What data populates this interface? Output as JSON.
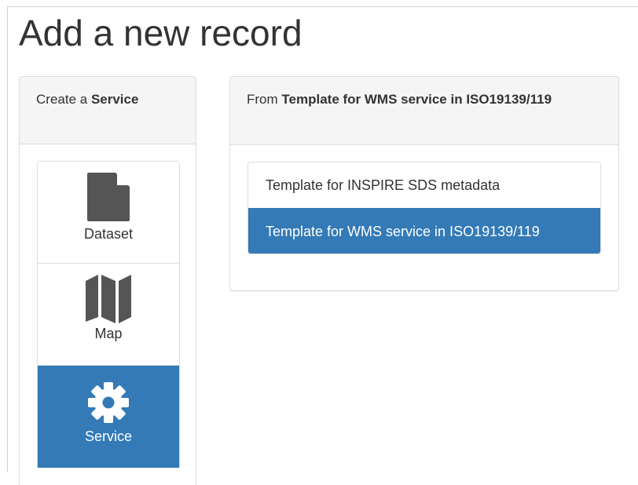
{
  "page": {
    "title": "Add a new record"
  },
  "left_panel": {
    "heading_prefix": "Create a",
    "heading_strong": "Service",
    "types": [
      {
        "label": "Dataset",
        "icon": "file-icon",
        "active": false
      },
      {
        "label": "Map",
        "icon": "map-icon",
        "active": false
      },
      {
        "label": "Service",
        "icon": "gear-icon",
        "active": true
      }
    ]
  },
  "right_panel": {
    "heading_prefix": "From",
    "heading_strong": "Template for WMS service in ISO19139/119",
    "templates": [
      {
        "label": "Template for INSPIRE SDS metadata",
        "active": false
      },
      {
        "label": "Template for WMS service in ISO19139/119",
        "active": true
      }
    ]
  },
  "colors": {
    "accent": "#337ab7",
    "heading_bg": "#f5f5f5",
    "icon_gray": "#555555"
  }
}
